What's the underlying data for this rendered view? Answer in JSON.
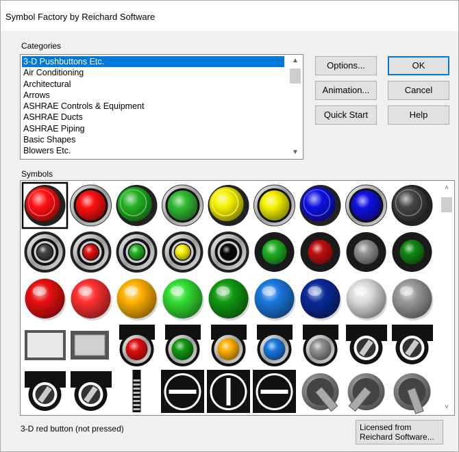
{
  "window": {
    "title": "Symbol Factory by Reichard Software"
  },
  "categories": {
    "label": "Categories",
    "items": [
      "3-D Pushbuttons Etc.",
      "Air Conditioning",
      "Architectural",
      "Arrows",
      "ASHRAE Controls & Equipment",
      "ASHRAE Ducts",
      "ASHRAE Piping",
      "Basic Shapes",
      "Blowers Etc."
    ],
    "selected_index": 0
  },
  "buttons": {
    "options": "Options...",
    "ok": "OK",
    "animation": "Animation...",
    "cancel": "Cancel",
    "quick_start": "Quick Start",
    "help": "Help"
  },
  "symbols": {
    "label": "Symbols",
    "selected_index": 0,
    "rows": [
      [
        {
          "type": "pushbutton",
          "color": "#ff1010"
        },
        {
          "type": "pushbutton-ring",
          "color": "#ff1010"
        },
        {
          "type": "pushbutton",
          "color": "#22b022"
        },
        {
          "type": "pushbutton-ring",
          "color": "#33bb33"
        },
        {
          "type": "pushbutton",
          "color": "#f5f000"
        },
        {
          "type": "pushbutton-ring",
          "color": "#f5f000"
        },
        {
          "type": "pushbutton",
          "color": "#1010e0"
        },
        {
          "type": "pushbutton-ring",
          "color": "#1010e0"
        },
        {
          "type": "pushbutton",
          "color": "#444444"
        }
      ],
      [
        {
          "type": "guarded",
          "color": "#444444"
        },
        {
          "type": "guarded",
          "color": "#e01010"
        },
        {
          "type": "guarded",
          "color": "#22b022"
        },
        {
          "type": "guarded",
          "color": "#f5f000"
        },
        {
          "type": "guarded",
          "color": "#080808"
        },
        {
          "type": "pilot-black",
          "color": "#22b022"
        },
        {
          "type": "pilot-black",
          "color": "#c01010"
        },
        {
          "type": "pilot-black",
          "color": "#909090"
        },
        {
          "type": "pilot-black",
          "color": "#118811"
        }
      ],
      [
        {
          "type": "glossy",
          "color": "#e81010"
        },
        {
          "type": "glossy",
          "color": "#ff3030"
        },
        {
          "type": "glossy",
          "color": "#ffb000"
        },
        {
          "type": "glossy",
          "color": "#33dd33"
        },
        {
          "type": "glossy",
          "color": "#119911"
        },
        {
          "type": "glossy",
          "color": "#1a78e0"
        },
        {
          "type": "glossy",
          "color": "#0a2a99"
        },
        {
          "type": "glossy",
          "color": "#dddddd"
        },
        {
          "type": "glossy",
          "color": "#999999"
        }
      ],
      [
        {
          "type": "rect-button",
          "color": "#e8e8e8"
        },
        {
          "type": "rect-button-small",
          "color": "#d0d0d0"
        },
        {
          "type": "lamp-housing",
          "color": "#e01010"
        },
        {
          "type": "lamp-housing",
          "color": "#119911"
        },
        {
          "type": "lamp-housing",
          "color": "#ffb000"
        },
        {
          "type": "lamp-housing",
          "color": "#1a78e0"
        },
        {
          "type": "lamp-housing",
          "color": "#909090"
        },
        {
          "type": "key-switch",
          "color": "#111111"
        },
        {
          "type": "key-switch-narrow",
          "color": "#111111"
        }
      ],
      [
        {
          "type": "key-switch",
          "color": "#111111"
        },
        {
          "type": "key-switch",
          "color": "#111111"
        },
        {
          "type": "slider",
          "color": "#111111"
        },
        {
          "type": "selector-square",
          "color": "#111111"
        },
        {
          "type": "selector-square-vert",
          "color": "#111111"
        },
        {
          "type": "selector-square",
          "color": "#111111"
        },
        {
          "type": "lever",
          "color": "#777777"
        },
        {
          "type": "lever-right",
          "color": "#777777"
        },
        {
          "type": "lever-up",
          "color": "#555555"
        }
      ]
    ]
  },
  "status": {
    "text": "3-D red button (not pressed)",
    "licensed_line1": "Licensed from",
    "licensed_line2": "Reichard Software..."
  }
}
